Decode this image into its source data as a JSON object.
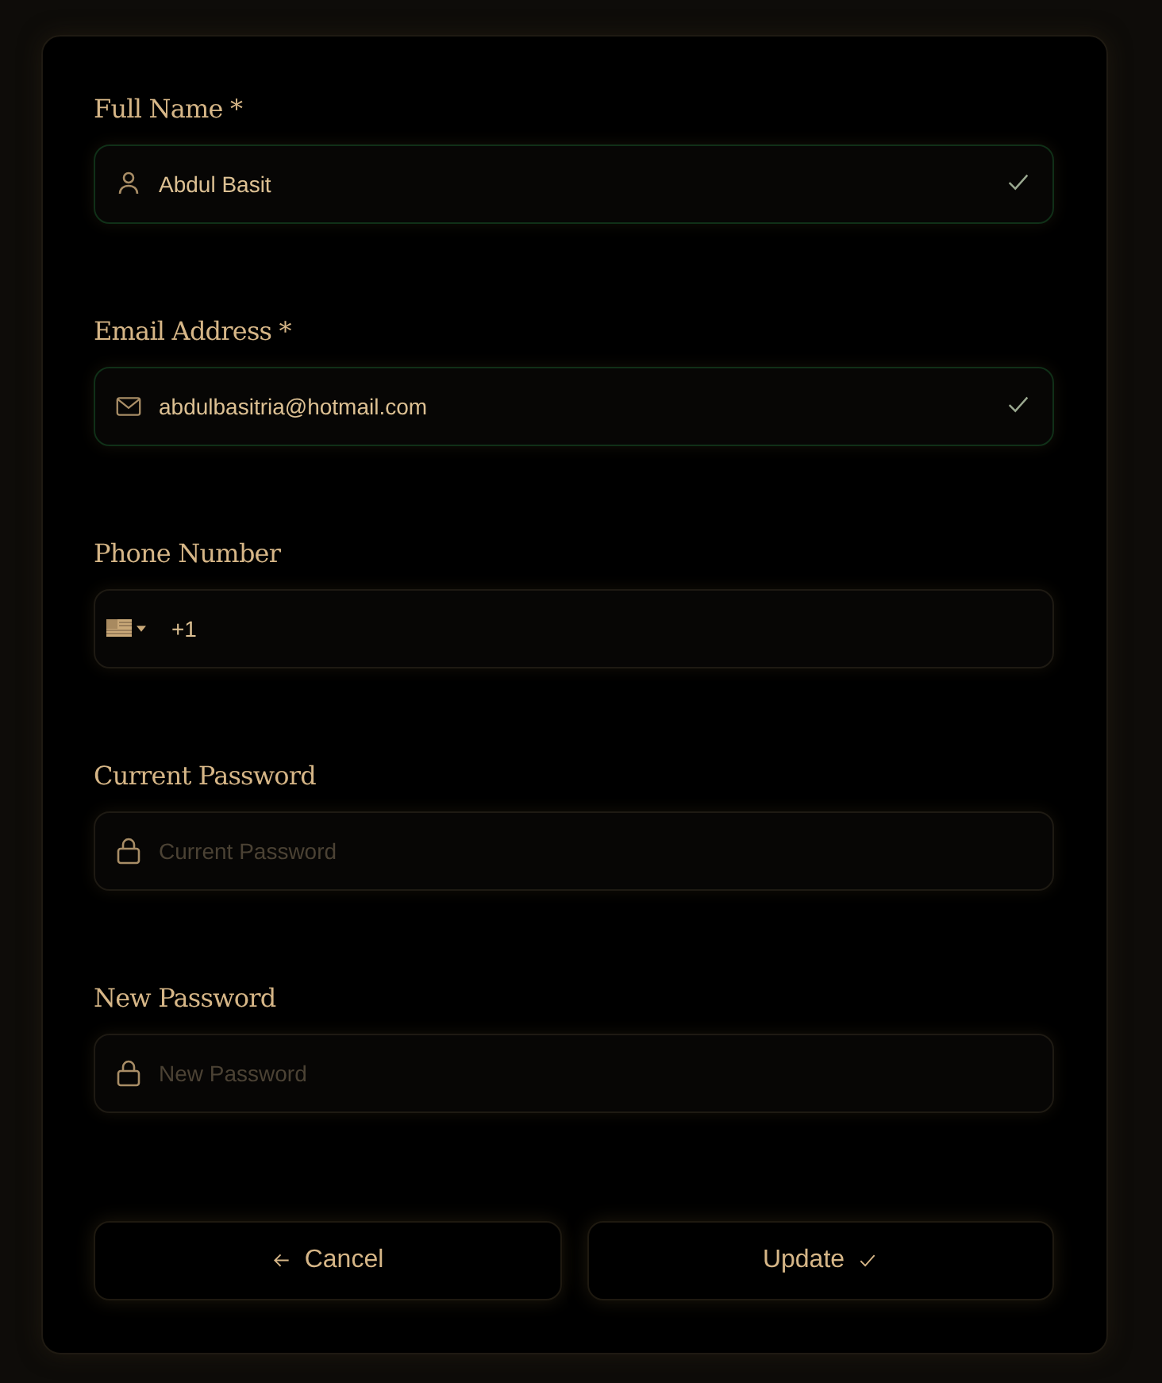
{
  "fields": [
    {
      "kind": "name",
      "label": "Full Name *",
      "value": "Abdul Basit",
      "valid": true
    },
    {
      "kind": "email",
      "label": "Email Address *",
      "value": "abdulbasitria@hotmail.com",
      "valid": true
    },
    {
      "kind": "phone",
      "label": "Phone Number",
      "value": "+1",
      "valid": false
    },
    {
      "kind": "password",
      "label": "Current Password",
      "placeholder": "Current Password",
      "valid": false
    },
    {
      "kind": "password",
      "label": "New Password",
      "placeholder": "New Password",
      "valid": false
    }
  ],
  "buttons": [
    {
      "kind": "back",
      "label": "Cancel"
    },
    {
      "kind": "submit",
      "label": "Update"
    }
  ]
}
